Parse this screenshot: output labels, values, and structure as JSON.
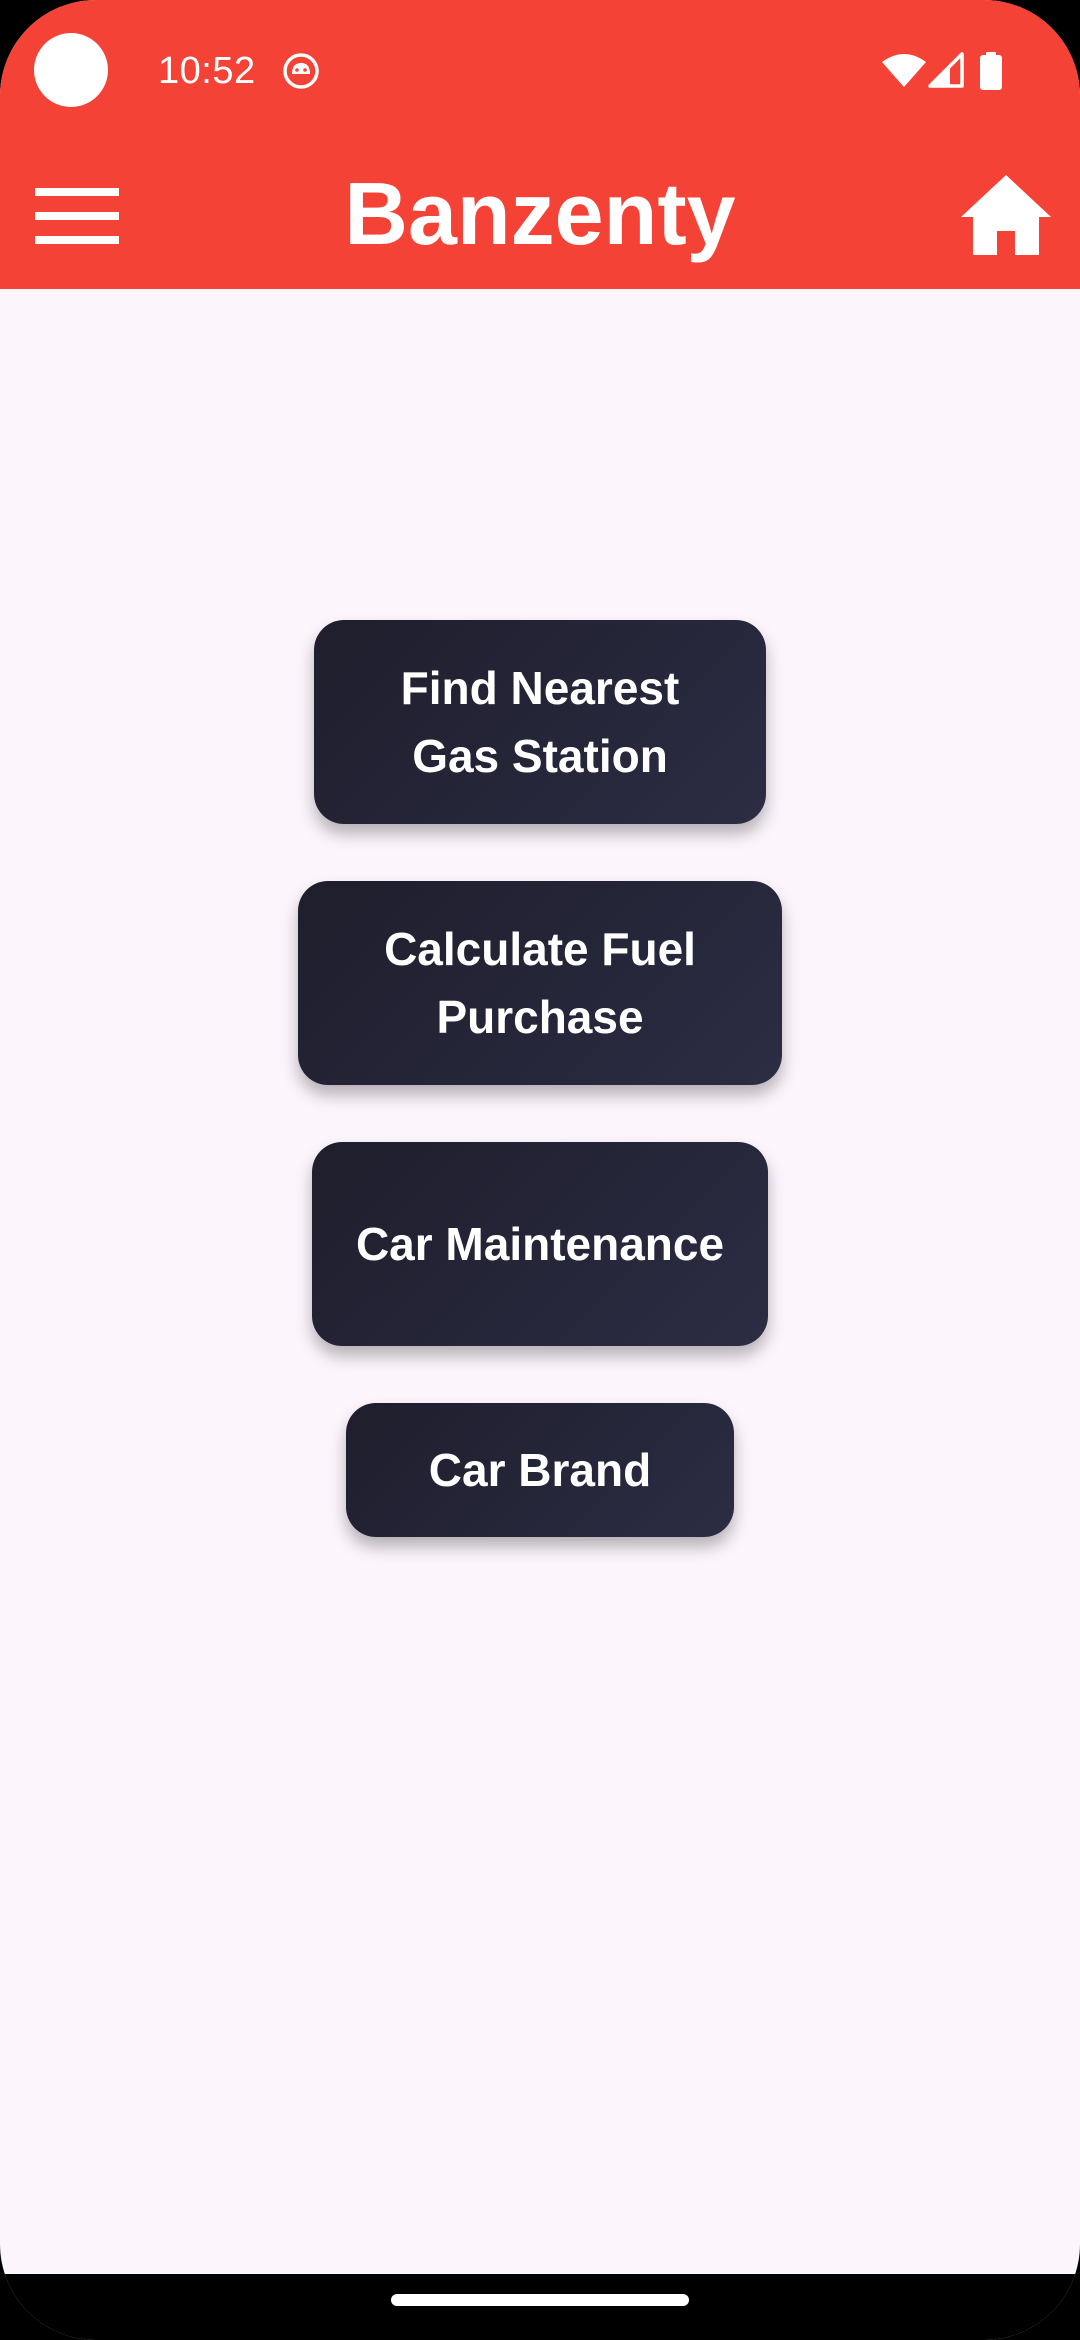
{
  "status_bar": {
    "time": "10:52",
    "icons": [
      "camera-dot",
      "android-debug-icon",
      "wifi-icon",
      "signal-icon",
      "battery-icon"
    ]
  },
  "app_bar": {
    "title": "Banzenty",
    "left_icon": "menu-icon",
    "right_icon": "home-icon",
    "background_color": "#F44336"
  },
  "main": {
    "buttons": [
      {
        "label": "Find Nearest Gas Station"
      },
      {
        "label": "Calculate Fuel Purchase"
      },
      {
        "label": "Car Maintenance"
      },
      {
        "label": "Car Brand"
      }
    ],
    "button_color": "#24243A",
    "background_color": "#FCF5FC"
  }
}
